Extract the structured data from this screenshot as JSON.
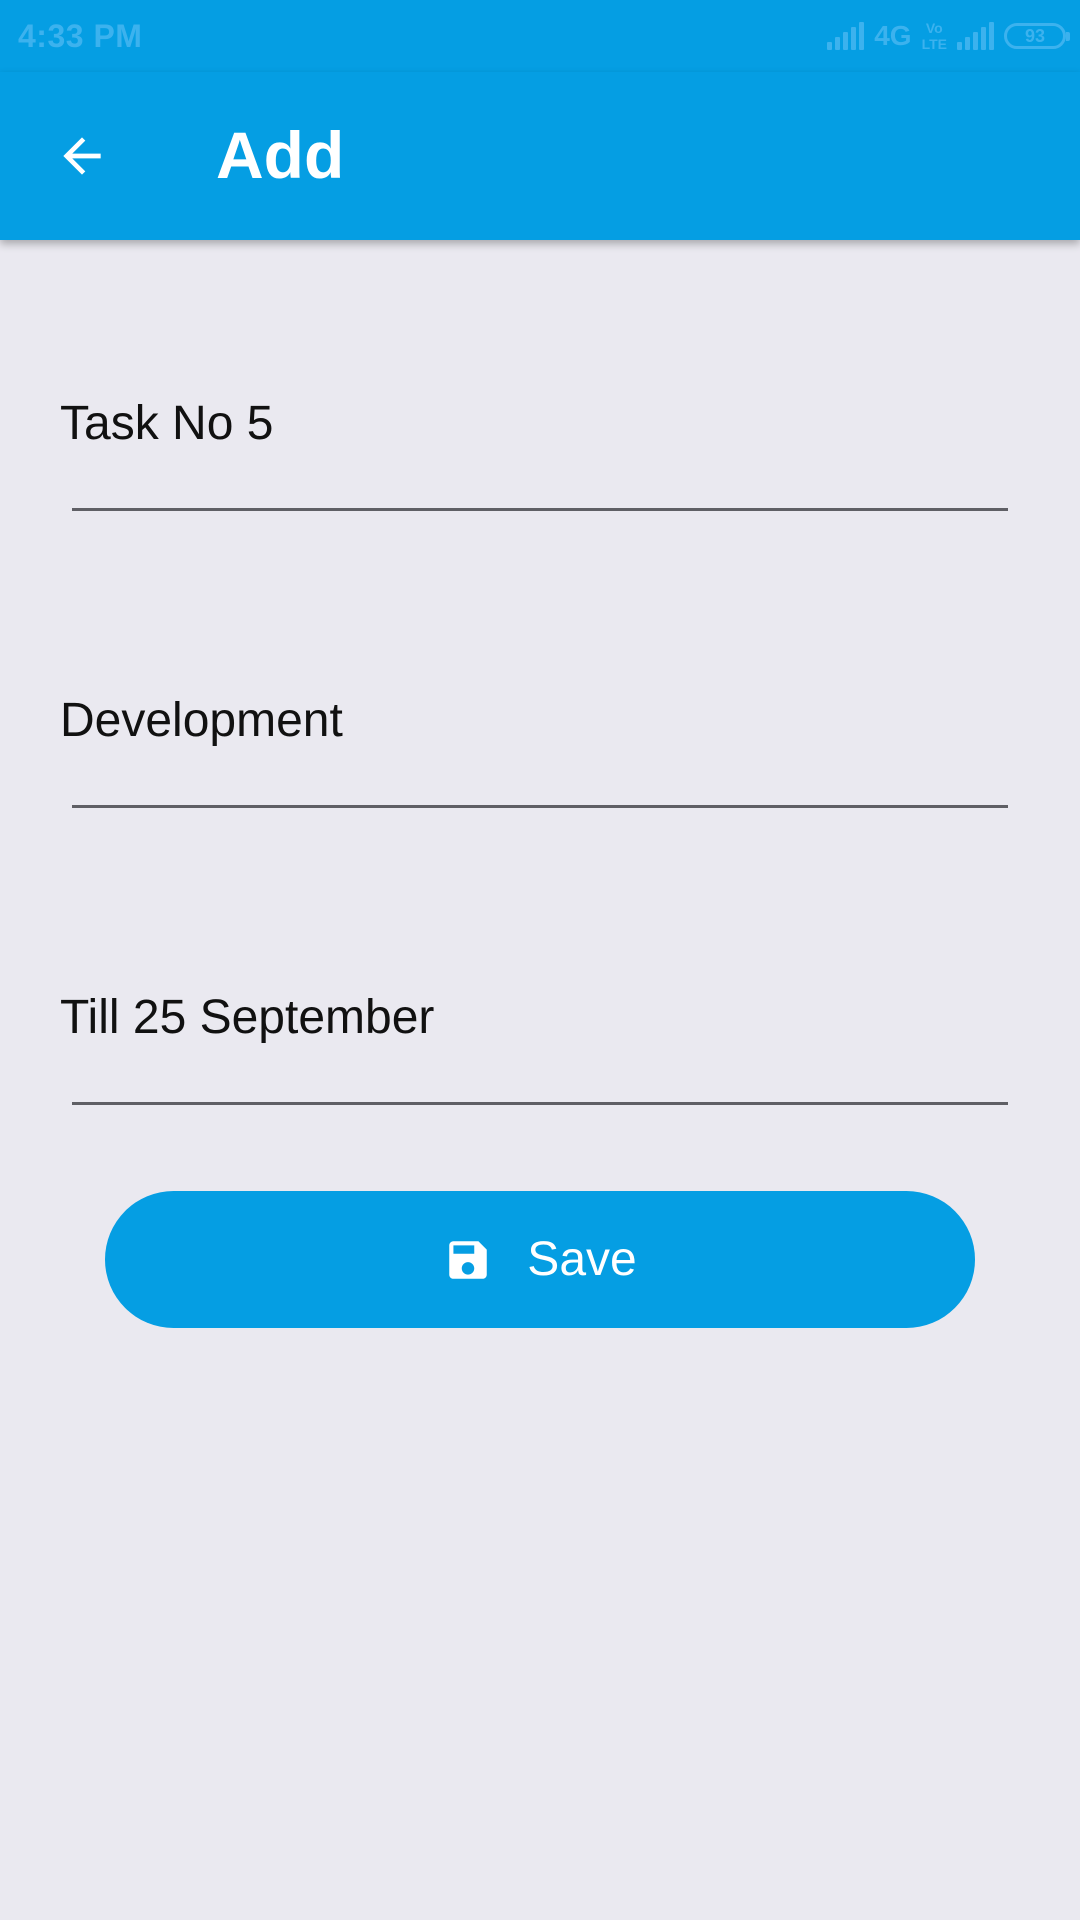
{
  "status_bar": {
    "time": "4:33 PM",
    "network": "4G",
    "volte_top": "Vo",
    "volte_bottom": "LTE",
    "battery": "93"
  },
  "app_bar": {
    "title": "Add",
    "back_icon": "arrow-back-icon"
  },
  "form": {
    "fields": [
      {
        "value": "Task No 5"
      },
      {
        "value": "Development"
      },
      {
        "value": "Till 25 September"
      }
    ]
  },
  "save_button": {
    "label": "Save",
    "icon": "save-icon"
  },
  "colors": {
    "primary": "#059ee3",
    "background": "#eae9f0"
  }
}
